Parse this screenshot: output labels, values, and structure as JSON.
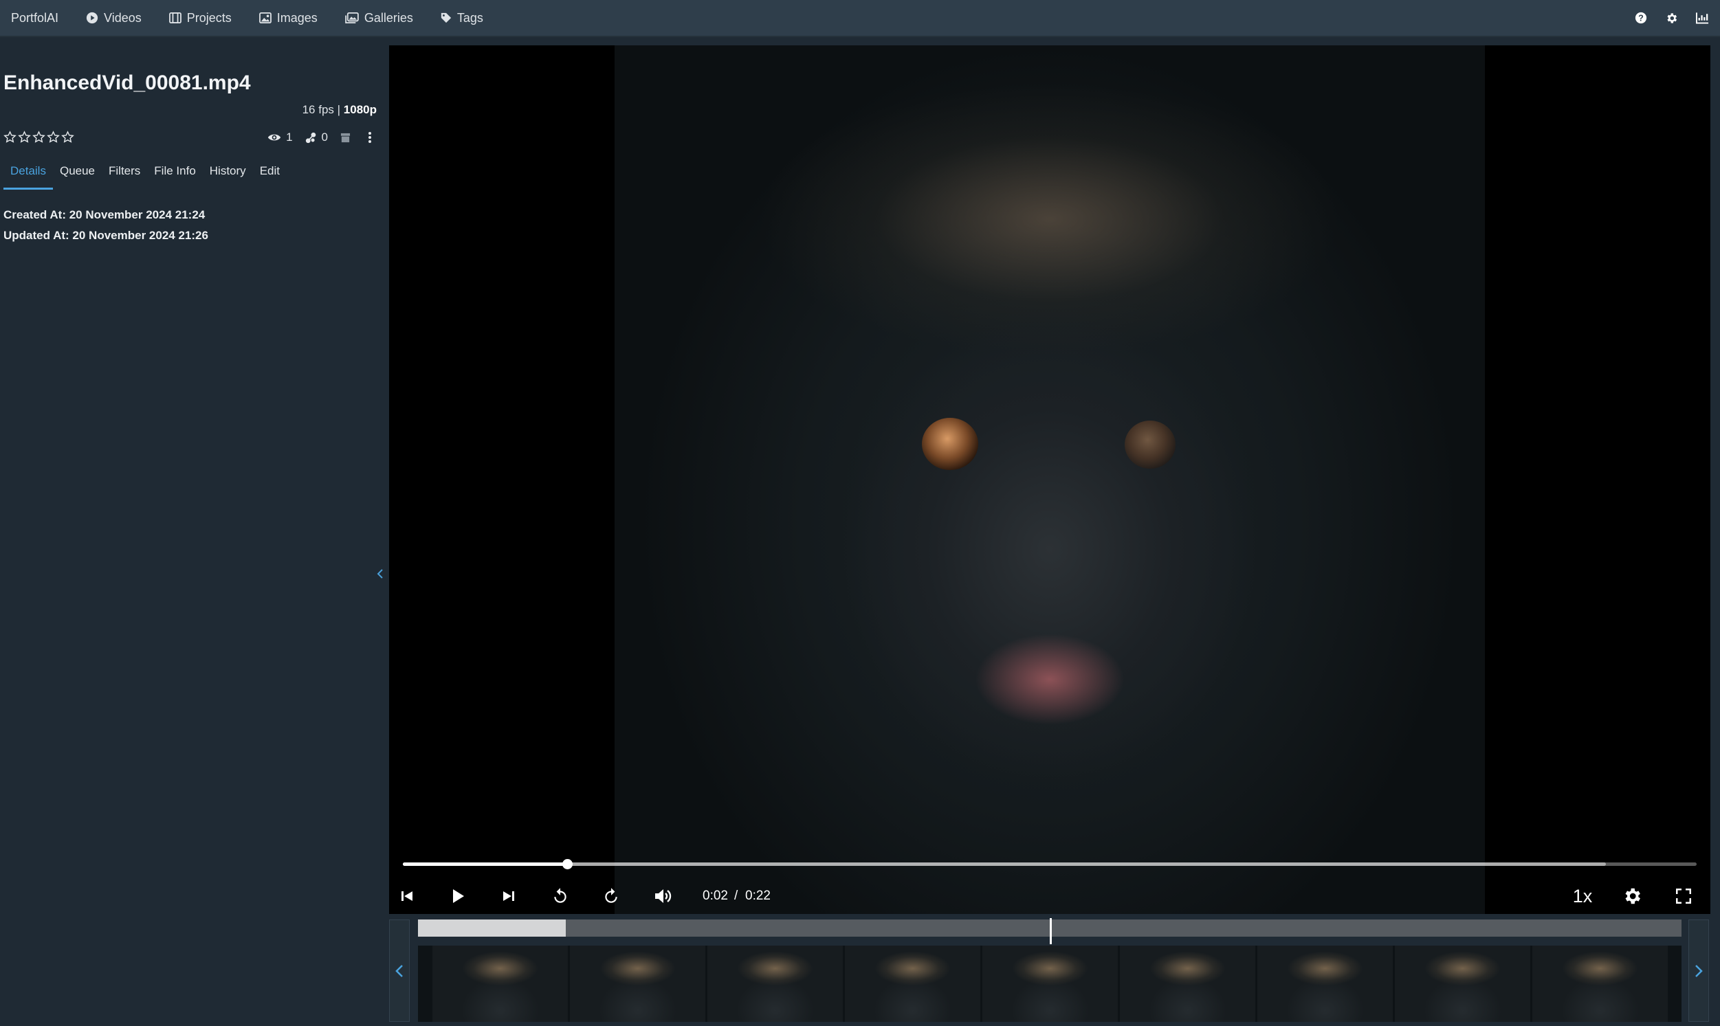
{
  "app": {
    "brand": "PortfolAI"
  },
  "nav": {
    "items": [
      {
        "label": "Videos",
        "icon": "play-circle-icon"
      },
      {
        "label": "Projects",
        "icon": "film-icon"
      },
      {
        "label": "Images",
        "icon": "image-icon"
      },
      {
        "label": "Galleries",
        "icon": "images-icon"
      },
      {
        "label": "Tags",
        "icon": "tag-icon"
      }
    ],
    "right_icons": [
      "help-icon",
      "gear-icon",
      "chart-icon"
    ]
  },
  "sidebar": {
    "title": "EnhancedVid_00081.mp4",
    "fps": "16 fps",
    "separator": "|",
    "resolution": "1080p",
    "rating": {
      "value": 0,
      "max": 5
    },
    "views": "1",
    "likes": "0",
    "tabs": [
      {
        "label": "Details",
        "active": true
      },
      {
        "label": "Queue",
        "active": false
      },
      {
        "label": "Filters",
        "active": false
      },
      {
        "label": "File Info",
        "active": false
      },
      {
        "label": "History",
        "active": false
      },
      {
        "label": "Edit",
        "active": false
      }
    ],
    "details": {
      "created": "Created At: 20 November 2024 21:24",
      "updated": "Updated At: 20 November 2024 21:26"
    },
    "collapse_icon": "chevron-left-icon"
  },
  "player": {
    "current_time": "0:02",
    "time_separator": "/",
    "duration": "0:22",
    "played_fraction": 0.127,
    "buffered_fraction": 0.93,
    "speed": "1x"
  },
  "timeline": {
    "window_fraction": 0.117,
    "marker_fraction": 0.5,
    "thumbnail_count": 9
  },
  "colors": {
    "accent": "#4aa3df",
    "navbar": "#2f3e4b",
    "background": "#1f2a34"
  }
}
